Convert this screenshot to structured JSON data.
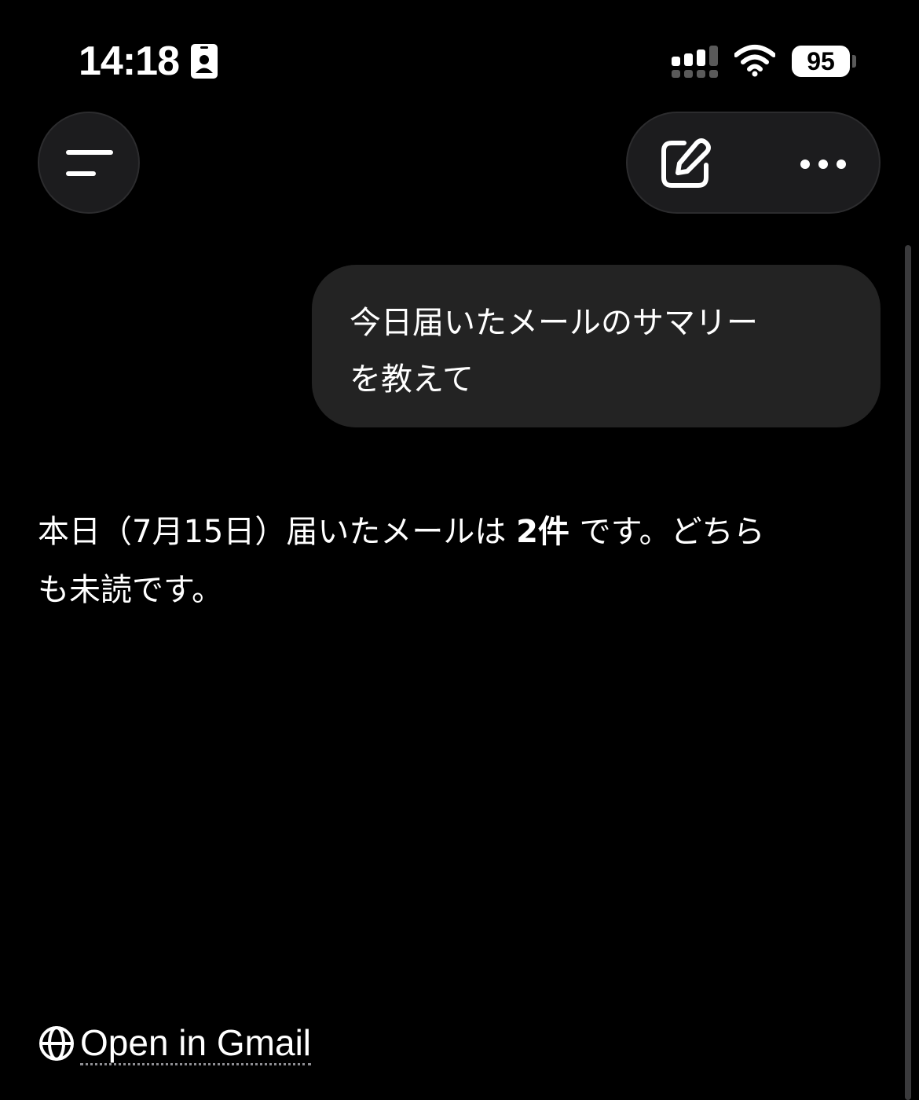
{
  "status_bar": {
    "time": "14:18",
    "battery_level": "95",
    "icons": [
      "id-card-icon",
      "cellular-signal-icon",
      "wifi-icon",
      "battery-icon"
    ]
  },
  "header": {
    "menu_icon": "menu-lines-icon",
    "edit_icon": "compose-icon",
    "more_icon": "ellipsis-icon"
  },
  "conversation": {
    "user_message_line1": "今日届いたメールのサマリー",
    "user_message_line2": "を教えて",
    "assistant_part1": "本日（7月15日）届いたメールは ",
    "assistant_bold": "2件",
    "assistant_part2": " です。どちら",
    "assistant_part3": "も未読です。"
  },
  "footer": {
    "link_icon": "globe-icon",
    "link_label": "Open in Gmail"
  },
  "colors": {
    "background": "#000000",
    "bubble": "#232323",
    "button": "#1c1c1e",
    "text": "#ffffff"
  }
}
